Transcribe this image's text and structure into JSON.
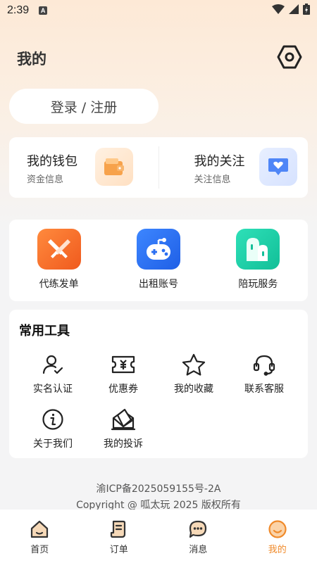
{
  "status_bar": {
    "time": "2:39",
    "notif_badge": "A"
  },
  "header": {
    "title": "我的"
  },
  "login": {
    "label": "登录 / 注册"
  },
  "wallet_card": {
    "wallet": {
      "title": "我的钱包",
      "subtitle": "资金信息"
    },
    "follow": {
      "title": "我的关注",
      "subtitle": "关注信息"
    }
  },
  "services": [
    {
      "label": "代练发单",
      "icon": "swords-icon",
      "color": "#f26b2a"
    },
    {
      "label": "出租账号",
      "icon": "gamepad-icon",
      "color": "#2b6ff2"
    },
    {
      "label": "陪玩服务",
      "icon": "companion-icon",
      "color": "#16c9a5"
    }
  ],
  "tools": {
    "title": "常用工具",
    "items": [
      {
        "label": "实名认证",
        "icon": "user-verify-icon"
      },
      {
        "label": "优惠券",
        "icon": "coupon-icon"
      },
      {
        "label": "我的收藏",
        "icon": "star-icon"
      },
      {
        "label": "联系客服",
        "icon": "headset-icon"
      },
      {
        "label": "关于我们",
        "icon": "info-icon"
      },
      {
        "label": "我的投诉",
        "icon": "complaint-mail-icon"
      }
    ]
  },
  "footer": {
    "icp": "渝ICP备2025059155号-2A",
    "copyright": "Copyright @ 呱太玩 2025 版权所有"
  },
  "tabbar": {
    "items": [
      {
        "label": "首页",
        "icon": "home-icon"
      },
      {
        "label": "订单",
        "icon": "order-icon"
      },
      {
        "label": "消息",
        "icon": "message-icon"
      },
      {
        "label": "我的",
        "icon": "profile-icon"
      }
    ],
    "active_index": 3,
    "active_color": "#f08a2a"
  }
}
